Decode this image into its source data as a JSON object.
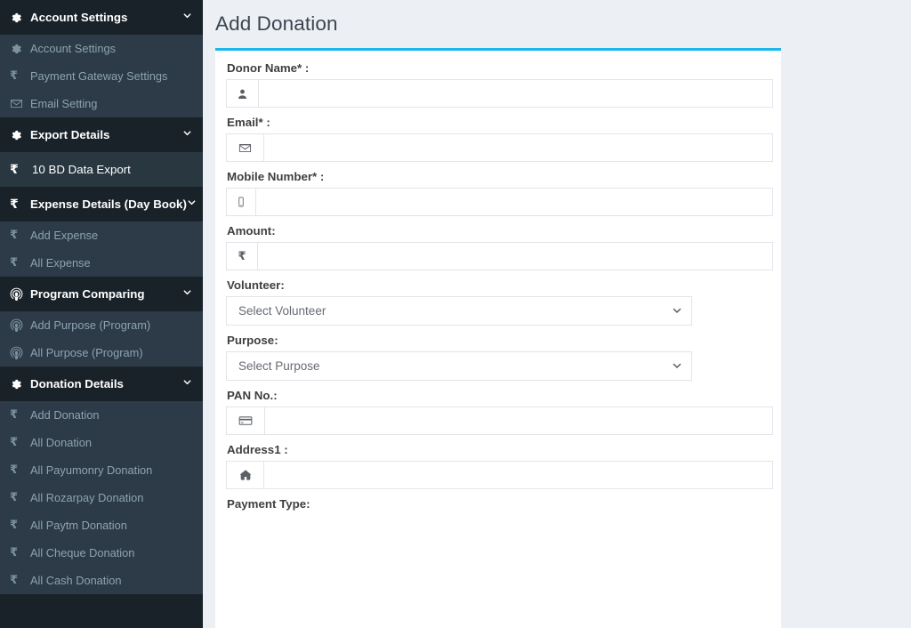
{
  "sidebar": {
    "groups": [
      {
        "type": "parent",
        "icon": "gear-icon",
        "label": "Account Settings",
        "chevron": "⌄",
        "children": [
          {
            "icon": "gear-icon",
            "label": "Account Settings"
          },
          {
            "icon": "rupee-icon",
            "label": "Payment Gateway Settings"
          },
          {
            "icon": "envelope-icon",
            "label": "Email Setting"
          }
        ]
      },
      {
        "type": "parent",
        "icon": "gear-icon",
        "label": "Export Details",
        "chevron": "⌄",
        "children": []
      },
      {
        "type": "active",
        "icon": "rupee-icon",
        "label": "10 BD Data Export"
      },
      {
        "type": "parent",
        "icon": "rupee-icon",
        "label": "Expense Details (Day Book)",
        "chevron": "⌄",
        "children": [
          {
            "icon": "rupee-icon",
            "label": "Add Expense"
          },
          {
            "icon": "rupee-icon",
            "label": "All Expense"
          }
        ]
      },
      {
        "type": "parent",
        "icon": "podcast-icon",
        "label": "Program Comparing",
        "chevron": "⌄",
        "children": [
          {
            "icon": "podcast-icon",
            "label": "Add Purpose (Program)"
          },
          {
            "icon": "podcast-icon",
            "label": "All Purpose (Program)"
          }
        ]
      },
      {
        "type": "parent",
        "icon": "gear-icon",
        "label": "Donation Details",
        "chevron": "⌄",
        "children": [
          {
            "icon": "rupee-icon",
            "label": "Add Donation"
          },
          {
            "icon": "rupee-icon",
            "label": "All Donation"
          },
          {
            "icon": "rupee-icon",
            "label": "All Payumonry Donation"
          },
          {
            "icon": "rupee-icon",
            "label": "All Rozarpay Donation"
          },
          {
            "icon": "rupee-icon",
            "label": "All Paytm Donation"
          },
          {
            "icon": "rupee-icon",
            "label": "All Cheque Donation"
          },
          {
            "icon": "rupee-icon",
            "label": "All Cash Donation"
          }
        ]
      }
    ]
  },
  "main": {
    "page_title": "Add Donation",
    "accent_color": "#1cb7ea",
    "fields": [
      {
        "id": "donor-name",
        "label": "Donor Name* :",
        "control": "input",
        "icon": "user-icon",
        "value": "",
        "placeholder": ""
      },
      {
        "id": "email",
        "label": "Email* :",
        "control": "input",
        "icon": "envelope-icon",
        "value": "",
        "placeholder": ""
      },
      {
        "id": "mobile-number",
        "label": "Mobile Number* :",
        "control": "input",
        "icon": "mobile-icon",
        "value": "",
        "placeholder": ""
      },
      {
        "id": "amount",
        "label": "Amount:",
        "control": "input",
        "icon": "rupee-icon",
        "value": "",
        "placeholder": ""
      },
      {
        "id": "volunteer",
        "label": "Volunteer:",
        "control": "select",
        "selected": "Select Volunteer",
        "options": [
          "Select Volunteer"
        ]
      },
      {
        "id": "purpose",
        "label": "Purpose:",
        "control": "select",
        "selected": "Select Purpose",
        "options": [
          "Select Purpose"
        ]
      },
      {
        "id": "pan-no",
        "label": "PAN No.:",
        "control": "input",
        "icon": "credit-card-icon",
        "value": "",
        "placeholder": ""
      },
      {
        "id": "address1",
        "label": "Address1 :",
        "control": "input",
        "icon": "home-icon",
        "value": "",
        "placeholder": ""
      },
      {
        "id": "payment-type",
        "label": "Payment Type:",
        "control": "cut-off"
      }
    ]
  }
}
